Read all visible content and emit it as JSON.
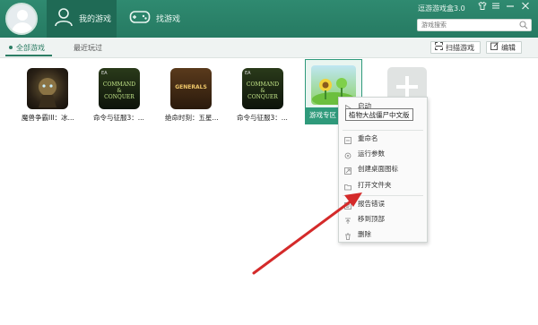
{
  "header": {
    "tabs": [
      {
        "label": "我的游戏",
        "icon": "user-icon"
      },
      {
        "label": "找游戏",
        "icon": "gamepad-icon"
      }
    ],
    "app_title": "逗游游戏盒3.0",
    "window_controls": {
      "skin": "shirt-icon",
      "menu": "menu-icon",
      "minimize": "minimize-icon",
      "close": "close-icon"
    },
    "search": {
      "placeholder": "游戏搜索",
      "icon": "search-icon"
    }
  },
  "subnav": {
    "tabs": [
      {
        "label": "全部游戏",
        "active": true
      },
      {
        "label": "最近玩过",
        "active": false
      }
    ],
    "scan_label": "扫描游戏",
    "edit_label": "编辑"
  },
  "games": [
    {
      "name": "魔兽争霸III：冰...",
      "icon": "warcraft3-icon"
    },
    {
      "name": "命令与征服3：...",
      "icon": "command-conquer-icon",
      "logo": "COMMAND & CONQUER"
    },
    {
      "name": "绝命时刻：五星...",
      "icon": "generals-icon",
      "logo": "GENERALS"
    },
    {
      "name": "命令与征服3：...",
      "icon": "command-conquer-icon",
      "logo": "COMMAND & CONQUER"
    }
  ],
  "selected_game": {
    "zone_label": "游戏专区",
    "icon": "plants-vs-zombies-icon",
    "tooltip": "植物大战僵尸中文版"
  },
  "context_menu": {
    "items": [
      {
        "label": "启动",
        "icon": "play-icon"
      },
      {
        "label": "重命名",
        "icon": "rename-icon"
      },
      {
        "label": "运行参数",
        "icon": "settings-icon"
      },
      {
        "label": "创建桌面图标",
        "icon": "desktop-shortcut-icon"
      },
      {
        "label": "打开文件夹",
        "icon": "folder-icon"
      },
      {
        "label": "报告错误",
        "icon": "report-icon"
      },
      {
        "label": "移到顶部",
        "icon": "move-top-icon"
      },
      {
        "label": "删除",
        "icon": "delete-icon"
      }
    ]
  },
  "colors": {
    "primary": "#2a7f66",
    "accent": "#2f9a7b",
    "arrow": "#d42a2a"
  }
}
